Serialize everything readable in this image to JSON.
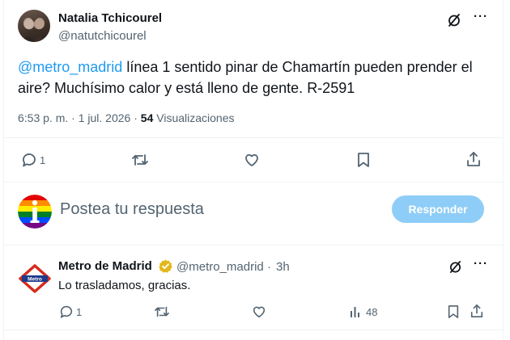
{
  "tweet": {
    "author_name": "Natalia Tchicourel",
    "author_handle": "@natutchicourel",
    "mention": "@metro_madrid",
    "text": " línea 1 sentido pinar de Chamartín pueden prender el aire? Muchísimo calor y está lleno de gente. R-2591",
    "time": "6:53 p. m.",
    "separator": "·",
    "date": "1 jul. 2026",
    "views_count": "54",
    "views_label": "Visualizaciones",
    "actions": {
      "reply_count": "1",
      "retweet_count": "",
      "like_count": ""
    },
    "icons": [
      "grok-icon",
      "more-icon",
      "reply-icon",
      "retweet-icon",
      "like-icon",
      "bookmark-icon",
      "share-icon"
    ]
  },
  "composer": {
    "placeholder": "Postea tu respuesta",
    "button_label": "Responder"
  },
  "reply": {
    "author_name": "Metro de Madrid",
    "author_handle": "@metro_madrid",
    "separator": "·",
    "time": "3h",
    "text": "Lo trasladamos, gracias.",
    "actions": {
      "reply_count": "1",
      "views_count": "48"
    },
    "logo_text": "Metro"
  },
  "colors": {
    "text": "#0f1419",
    "secondary": "#536471",
    "link": "#1d9bf0",
    "button_disabled": "#8ecdf7",
    "verified_gold": "#e2b719",
    "metro_red": "#d52b1e",
    "divider": "#eff3f4"
  }
}
